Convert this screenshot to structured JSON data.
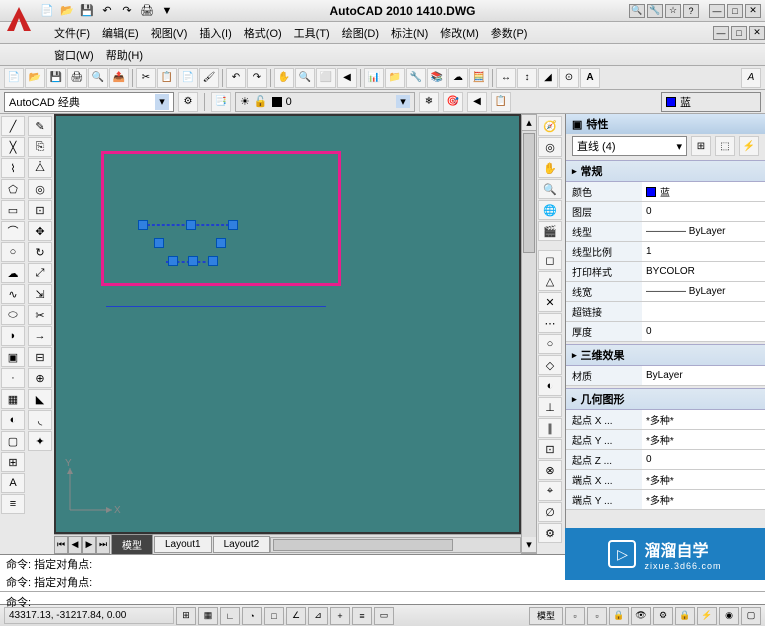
{
  "app": {
    "title": "AutoCAD 2010  1410.DWG"
  },
  "menus": {
    "file": "文件(F)",
    "edit": "编辑(E)",
    "view": "视图(V)",
    "insert": "插入(I)",
    "format": "格式(O)",
    "tools": "工具(T)",
    "draw": "绘图(D)",
    "annotate": "标注(N)",
    "modify": "修改(M)",
    "params": "参数(P)",
    "window": "窗口(W)",
    "help": "帮助(H)"
  },
  "workspace": {
    "current": "AutoCAD 经典"
  },
  "layer": {
    "current": "0",
    "color_display": "蓝"
  },
  "tabs": {
    "model": "模型",
    "layout1": "Layout1",
    "layout2": "Layout2"
  },
  "panel": {
    "title": "特性",
    "selection": "直线 (4)",
    "sections": {
      "general": "常规",
      "effect3d": "三维效果",
      "geometry": "几何图形"
    },
    "props": {
      "color": {
        "label": "颜色",
        "value": "蓝"
      },
      "layer": {
        "label": "图层",
        "value": "0"
      },
      "linetype": {
        "label": "线型",
        "value": "———— ByLayer"
      },
      "ltscale": {
        "label": "线型比例",
        "value": "1"
      },
      "plotstyle": {
        "label": "打印样式",
        "value": "BYCOLOR"
      },
      "lineweight": {
        "label": "线宽",
        "value": "———— ByLayer"
      },
      "hyperlink": {
        "label": "超链接",
        "value": ""
      },
      "thickness": {
        "label": "厚度",
        "value": "0"
      },
      "material": {
        "label": "材质",
        "value": "ByLayer"
      },
      "startx": {
        "label": "起点 X ...",
        "value": "*多种*"
      },
      "starty": {
        "label": "起点 Y ...",
        "value": "*多种*"
      },
      "startz": {
        "label": "起点 Z ...",
        "value": "0"
      },
      "endx": {
        "label": "端点 X ...",
        "value": "*多种*"
      },
      "endy": {
        "label": "端点 Y ...",
        "value": "*多种*"
      }
    }
  },
  "command": {
    "line1": "命令: 指定对角点:",
    "line2": "命令: 指定对角点:",
    "prompt": "命令:"
  },
  "status": {
    "coords": "43317.13, -31217.84, 0.00",
    "space": "模型"
  },
  "ucs": {
    "x": "X",
    "y": "Y"
  },
  "watermark": {
    "brand": "溜溜自学",
    "url": "zixue.3d66.com"
  }
}
